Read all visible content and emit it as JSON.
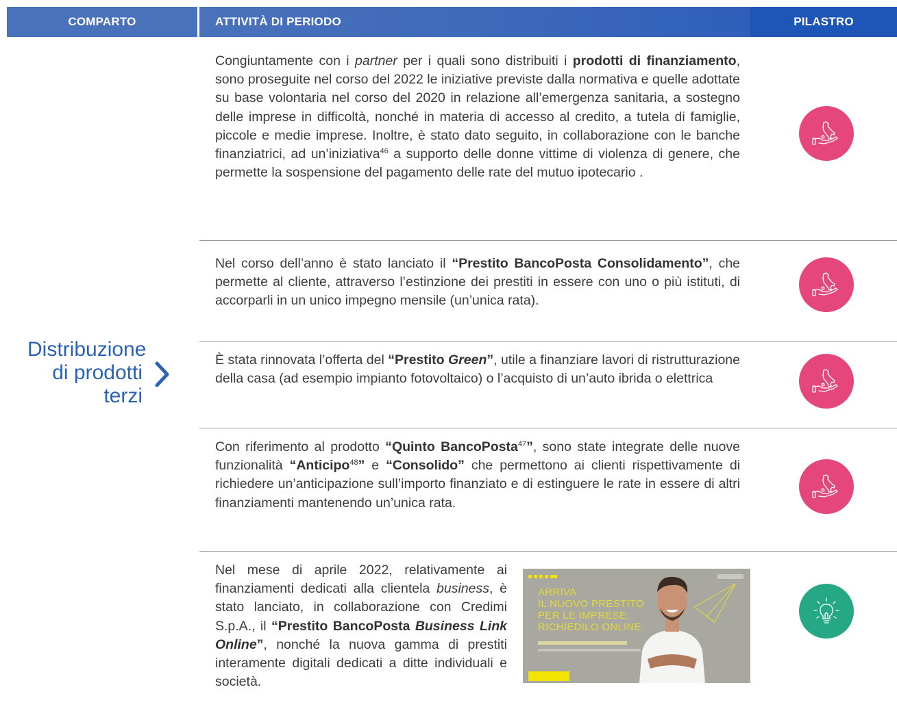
{
  "header": {
    "comparto": "COMPARTO",
    "attivita": "ATTIVITÀ DI PERIODO",
    "pilastro": "PILASTRO"
  },
  "comparto": {
    "line1": "Distribuzione",
    "line2": "di prodotti",
    "line3": "terzi"
  },
  "blocks": [
    {
      "t1": "Congiuntamente con i ",
      "i1": "partner",
      "t2": " per i quali sono distribuiti i ",
      "b1": "prodotti di fi­nanziamento",
      "t3": ", sono proseguite nel corso del 2022 le iniziative previste dalla normativa e quelle adottate su base volontaria nel corso del 2020 in relazione all’emergenza sanitaria, a sostegno delle imprese in difficoltà, nonché in materia di accesso al credito, a tutela di famiglie, piccole e me­die imprese. Inoltre, è stato dato seguito, in collaborazione con le banche finanziatrici, ad un’iniziativa",
      "sup1": "46",
      "t4": " a supporto delle donne vittime di violenza di genere, che permette la sospensione del pagamento delle rate del mutuo ipotecario ."
    },
    {
      "t1": "Nel corso dell’anno è stato lanciato il ",
      "b1": "“Prestito BancoPosta Consoli­damento”",
      "t2": ", che permette al cliente, attraverso l’estinzione dei prestiti in essere con uno o più istituti, di accorparli in un unico impegno mensile (un’unica rata)."
    },
    {
      "t1": "È stata rinnovata l’offerta del ",
      "b1": "“Prestito ",
      "bi1": "Green",
      "b2": "”",
      "t2": ", utile a finanziare lavori di ristrutturazione della casa (ad esempio impianto fotovoltaico) o l’acquisto di un’auto ibrida o elettrica"
    },
    {
      "t1": "Con riferimento al prodotto ",
      "b1": "“Quinto BancoPosta",
      "sup1": "47",
      "b2": "”",
      "t2": ", sono state integra­te delle nuove funzionalità ",
      "b3": "“Anticipo",
      "sup2": "48",
      "b4": "”",
      "t3": " e ",
      "b5": "“Consolido”",
      "t4": " che permettono ai clienti rispettivamente di richiedere un’anticipazione sull’importo finan­ziato e di estinguere le rate in essere di altri finanziamenti mantenendo un’unica rata."
    },
    {
      "t1": "Nel mese di aprile 2022, relativamente ai finanziamenti dedicati alla clientela ",
      "i1": "busi­ness",
      "t2": ", è stato lanciato, in collaborazione con Credimi S.p.A., il ",
      "b1": "“Prestito Banco­Posta ",
      "bi1": "Business Link Online",
      "b2": "”",
      "t3": ", nonché la nuova gamma di prestiti interamente digitali dedicati a ditte individuali e società."
    }
  ],
  "promo": {
    "headline_l1": "ARRIVA",
    "headline_l2": "IL NUOVO PRESTITO",
    "headline_l3": "PER LE IMPRESE:",
    "headline_l4": "RICHIEDILO ONLINE."
  },
  "icons": {
    "pillar_1": "hand-holding-italy-icon",
    "pillar_2": "lightbulb-icon"
  },
  "colors": {
    "header_blue": "#4a72bb",
    "pilastro_blue": "#1e56b8",
    "title_blue": "#2a62b6",
    "pink": "#e5467b",
    "teal": "#26a885"
  }
}
